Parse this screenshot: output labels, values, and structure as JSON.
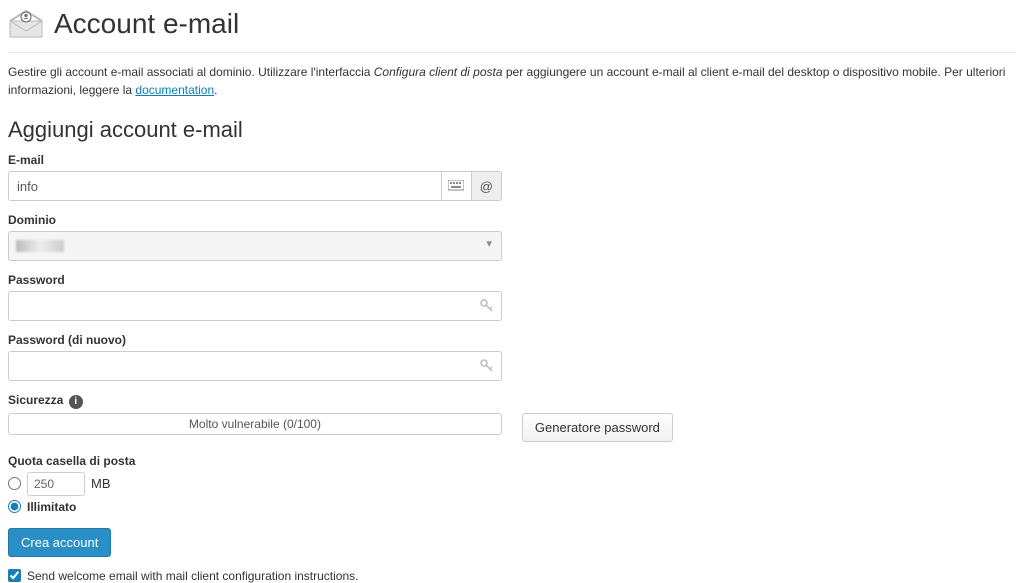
{
  "header": {
    "title": "Account e-mail"
  },
  "intro": {
    "pre_text": "Gestire gli account e-mail associati al dominio. Utilizzare l'interfaccia ",
    "em_text": "Configura client di posta",
    "mid_text": " per aggiungere un account e-mail al client e-mail del desktop o dispositivo mobile. Per ulteriori informazioni, leggere la ",
    "link_text": "documentation",
    "post_text": "."
  },
  "form": {
    "title": "Aggiungi account e-mail",
    "email": {
      "label": "E-mail",
      "value": "info",
      "at": "@"
    },
    "domain": {
      "label": "Dominio",
      "selected": ""
    },
    "password": {
      "label": "Password",
      "value": ""
    },
    "password_confirm": {
      "label": "Password (di nuovo)",
      "value": ""
    },
    "security": {
      "label": "Sicurezza",
      "strength_text": "Molto vulnerabile (0/100)"
    },
    "generator_btn": "Generatore password",
    "quota": {
      "label": "Quota casella di posta",
      "size_value": "250",
      "size_unit": "MB",
      "unlimited_label": "Illimitato"
    },
    "submit": "Crea account",
    "welcome_label": "Send welcome email with mail client configuration instructions."
  }
}
